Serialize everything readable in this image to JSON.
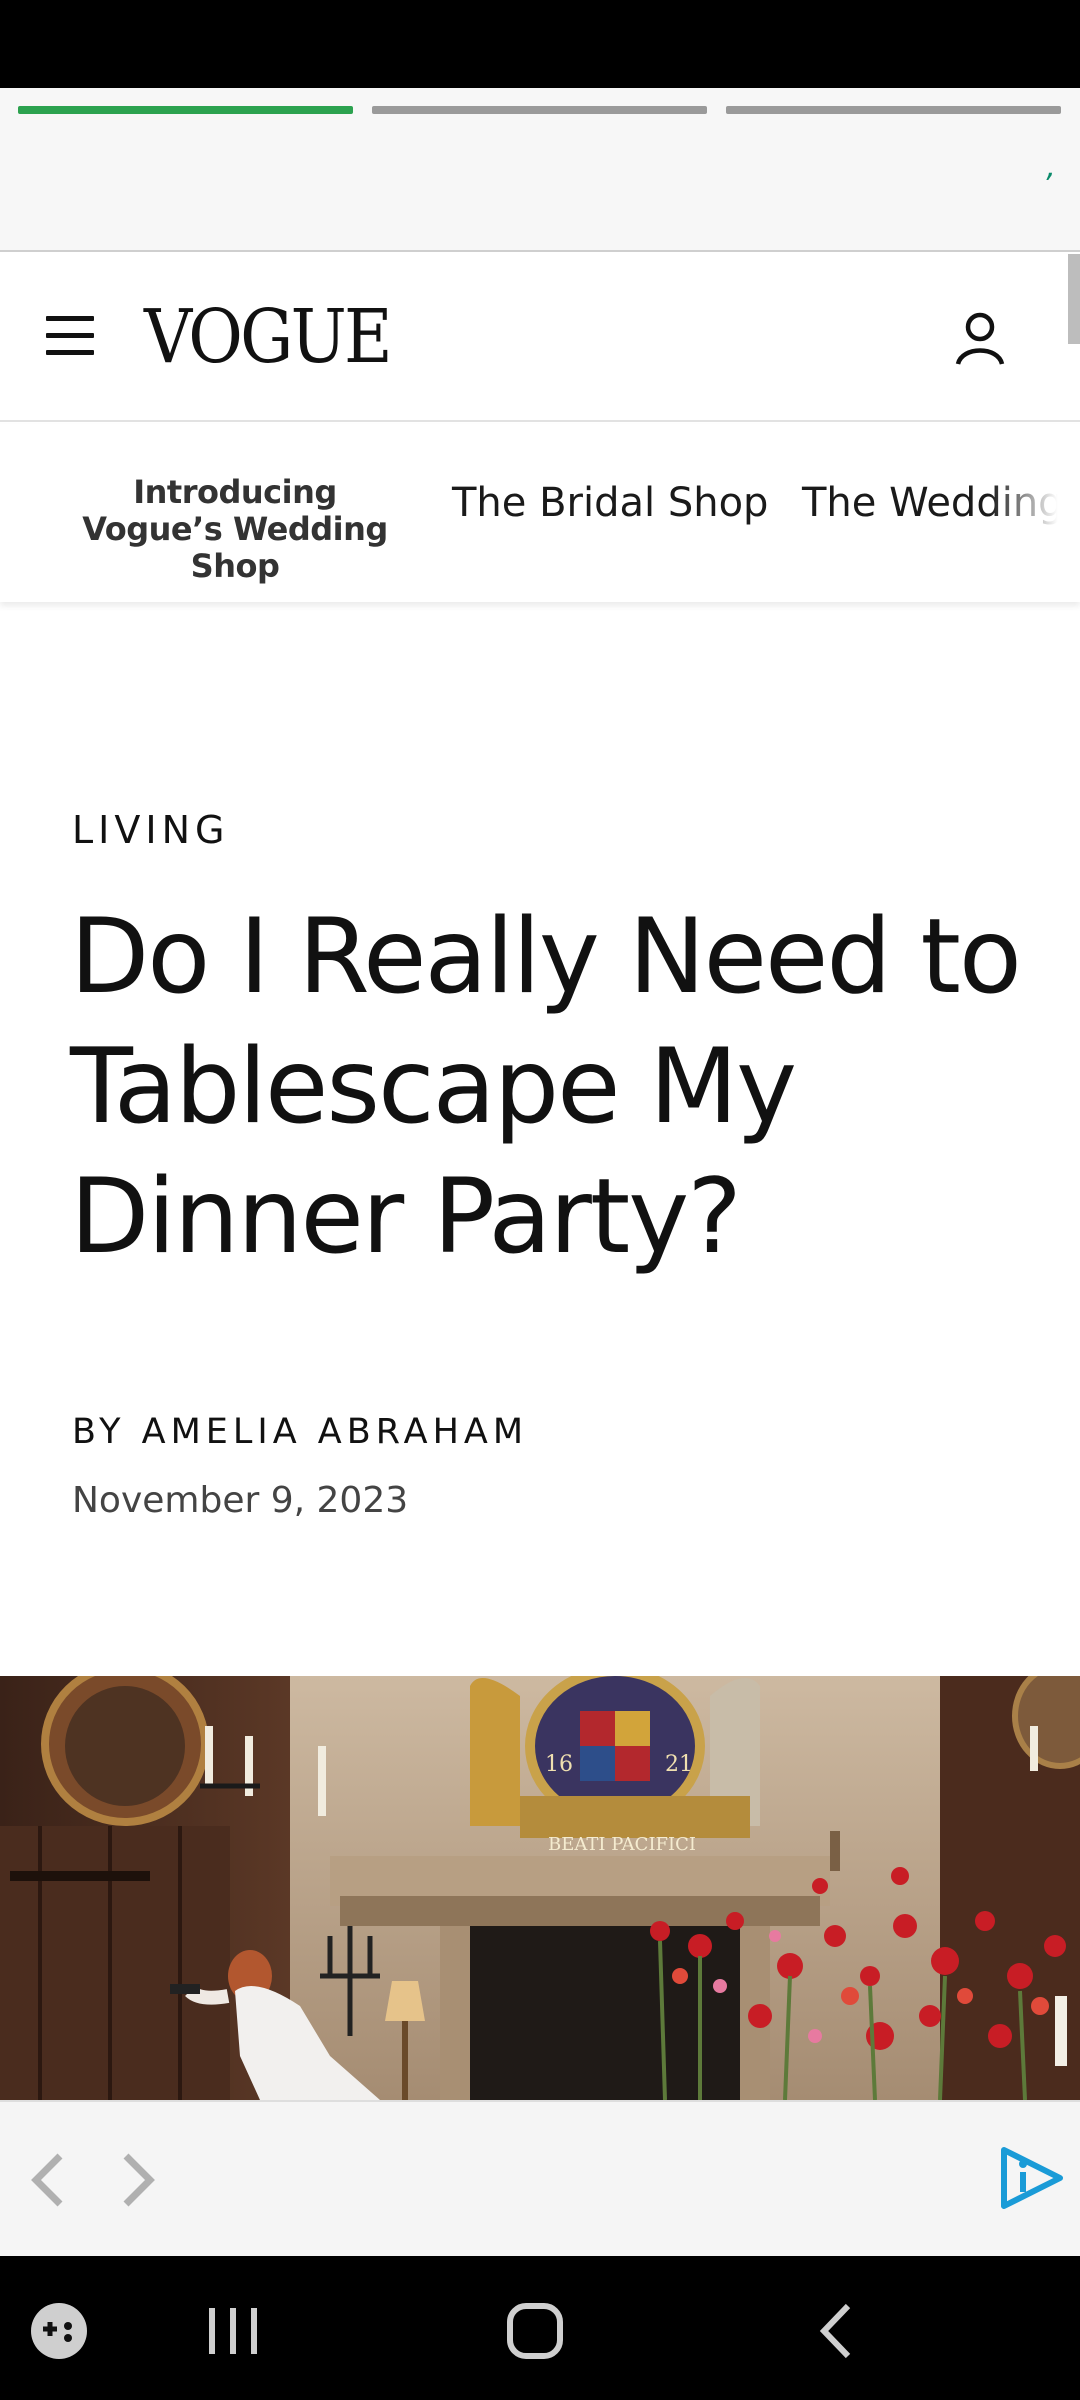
{
  "ad_top": {
    "progress_segments": [
      {
        "state": "active"
      },
      {
        "state": "inactive"
      },
      {
        "state": "inactive"
      }
    ],
    "mark": "ʼ"
  },
  "header": {
    "logo": "VOGUE",
    "menu_icon": "hamburger-menu-icon",
    "account_icon": "person-icon"
  },
  "nav": {
    "promo": "Introducing Vogue’s Wedding Shop",
    "links": [
      "The Bridal Shop",
      "The Wedding"
    ]
  },
  "article": {
    "rubric": "LIVING",
    "headline": "Do I Really Need to Tablescape My Dinner Party?",
    "byline_prefix": "BY",
    "author": "AMELIA ABRAHAM",
    "date": "November 9, 2023"
  },
  "hero_image": {
    "plaque_numbers": [
      "16",
      "21"
    ],
    "plaque_motto": "BEATI PACIFICI"
  },
  "ad_bottom": {
    "prev_icon": "chevron-left-icon",
    "next_icon": "chevron-right-icon",
    "brand_icon": "play-info-icon"
  },
  "system_nav": {
    "buttons": [
      "game-launcher-icon",
      "recent-apps-icon",
      "home-icon",
      "back-icon"
    ]
  },
  "colors": {
    "accent_green": "#2ca24f",
    "ad_blue": "#1a9bd7"
  }
}
